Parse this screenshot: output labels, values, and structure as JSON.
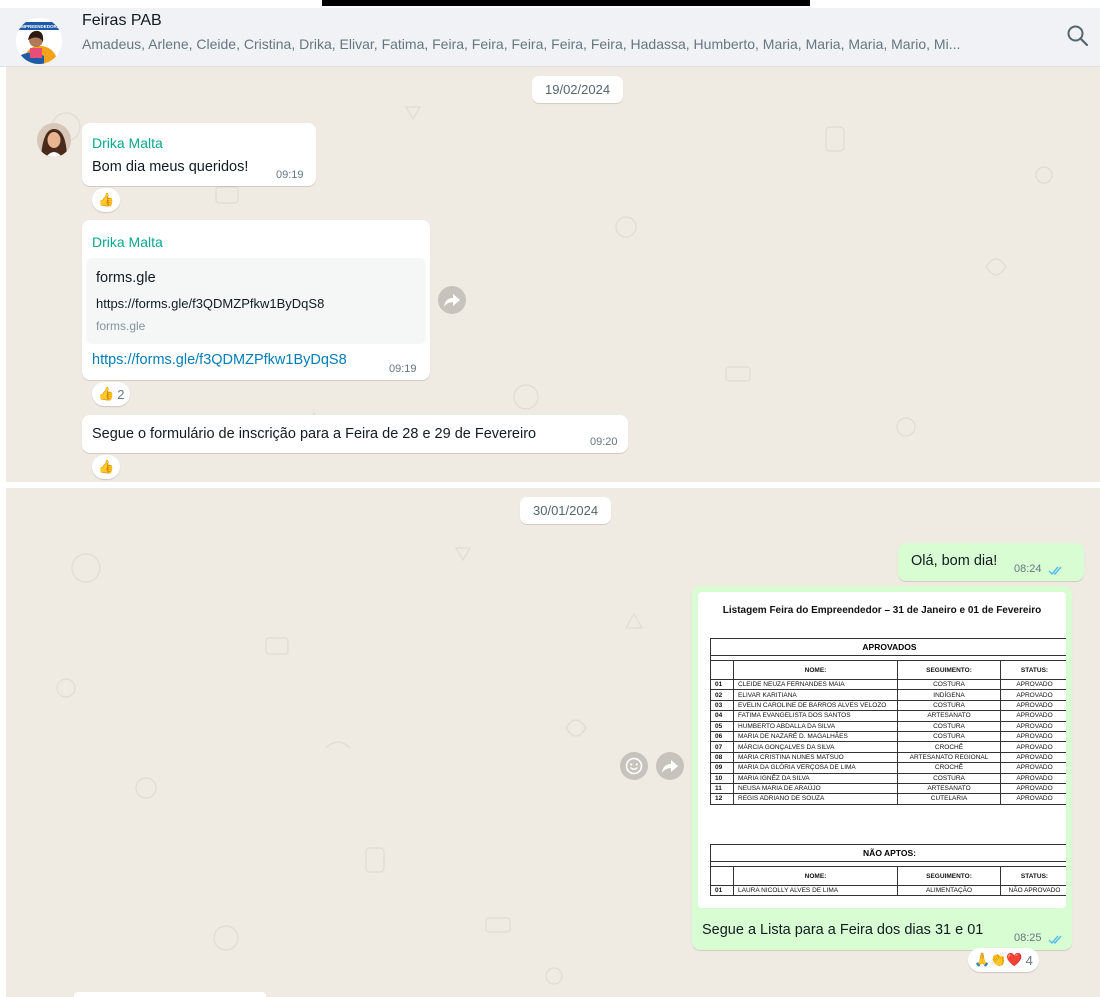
{
  "header": {
    "avatar_text": "EMPREENDEDORE",
    "title": "Feiras PAB",
    "members": "Amadeus, Arlene, Cleide, Cristina, Drika, Elivar, Fatima, Feira, Feira, Feira, Feira, Feira, Hadassa, Humberto, Maria, Maria, Maria, Mario, Mi..."
  },
  "panel1": {
    "date": "19/02/2024",
    "messages": [
      {
        "sender": "Drika Malta",
        "text": "Bom dia meus queridos!",
        "time": "09:19",
        "reaction": "👍"
      },
      {
        "sender": "Drika Malta",
        "preview_title": "forms.gle",
        "preview_desc": "https://forms.gle/f3QDMZPfkw1ByDqS8",
        "preview_domain": "forms.gle",
        "link": "https://forms.gle/f3QDMZPfkw1ByDqS8",
        "time": "09:19",
        "reaction": "👍",
        "reaction_count": "2"
      },
      {
        "text": "Segue o formulário de inscrição para a Feira de 28 e 29 de Fevereiro",
        "time": "09:20",
        "reaction": "👍"
      }
    ]
  },
  "panel2": {
    "date": "30/01/2024",
    "messages": [
      {
        "text": "Olá, bom dia!",
        "time": "08:24"
      },
      {
        "caption": "Segue  a Lista para a Feira dos dias 31 e 01",
        "time": "08:25",
        "reactions": "🙏👏❤️",
        "reaction_count": "4"
      }
    ],
    "document": {
      "title": "Listagem Feira do Empreendedor – 31 de Janeiro e 01 de Fevereiro",
      "approved_title": "APROVADOS",
      "not_approved_title": "NÃO APTOS:",
      "columns": [
        "NOME:",
        "SEGUIMENTO:",
        "STATUS:"
      ],
      "approved": [
        [
          "01",
          "CLEIDE NEUZA FERNANDES MAIA",
          "COSTURA",
          "APROVADO"
        ],
        [
          "02",
          "ELIVAR KARITIANA",
          "INDÍGENA",
          "APROVADO"
        ],
        [
          "03",
          "EVELIN CAROLINE DE BARROS ALVES VELOZO",
          "COSTURA",
          "APROVADO"
        ],
        [
          "04",
          "FATIMA EVANGELISTA DOS SANTOS",
          "ARTESANATO",
          "APROVADO"
        ],
        [
          "05",
          "HUMBERTO ABDALLA DA SILVA",
          "COSTURA",
          "APROVADO"
        ],
        [
          "06",
          "MARIA DE NAZARÉ D. MAGALHÃES",
          "COSTURA",
          "APROVADO"
        ],
        [
          "07",
          "MÁRCIA GONÇALVES DA SILVA",
          "CROCHÊ",
          "APROVADO"
        ],
        [
          "08",
          "MARIA CRISTINA NUNES MATSUO",
          "ARTESANATO REGIONAL",
          "APROVADO"
        ],
        [
          "09",
          "MARIA DA GLÓRIA VERÇOSA DE LIMA",
          "CROCHÊ",
          "APROVADO"
        ],
        [
          "10",
          "MARIA IGNÊZ DA SILVA",
          "COSTURA",
          "APROVADO"
        ],
        [
          "11",
          "NEUSA MARIA DE ARAÚJO",
          "ARTESANATO",
          "APROVADO"
        ],
        [
          "12",
          "REGIS ADRIANO DE SOUZA",
          "CUTELARIA",
          "APROVADO"
        ]
      ],
      "not_approved": [
        [
          "01",
          "LAURA NICOLLY ALVES DE LIMA",
          "ALIMENTAÇÃO",
          "NÃO APROVADO"
        ]
      ]
    }
  }
}
